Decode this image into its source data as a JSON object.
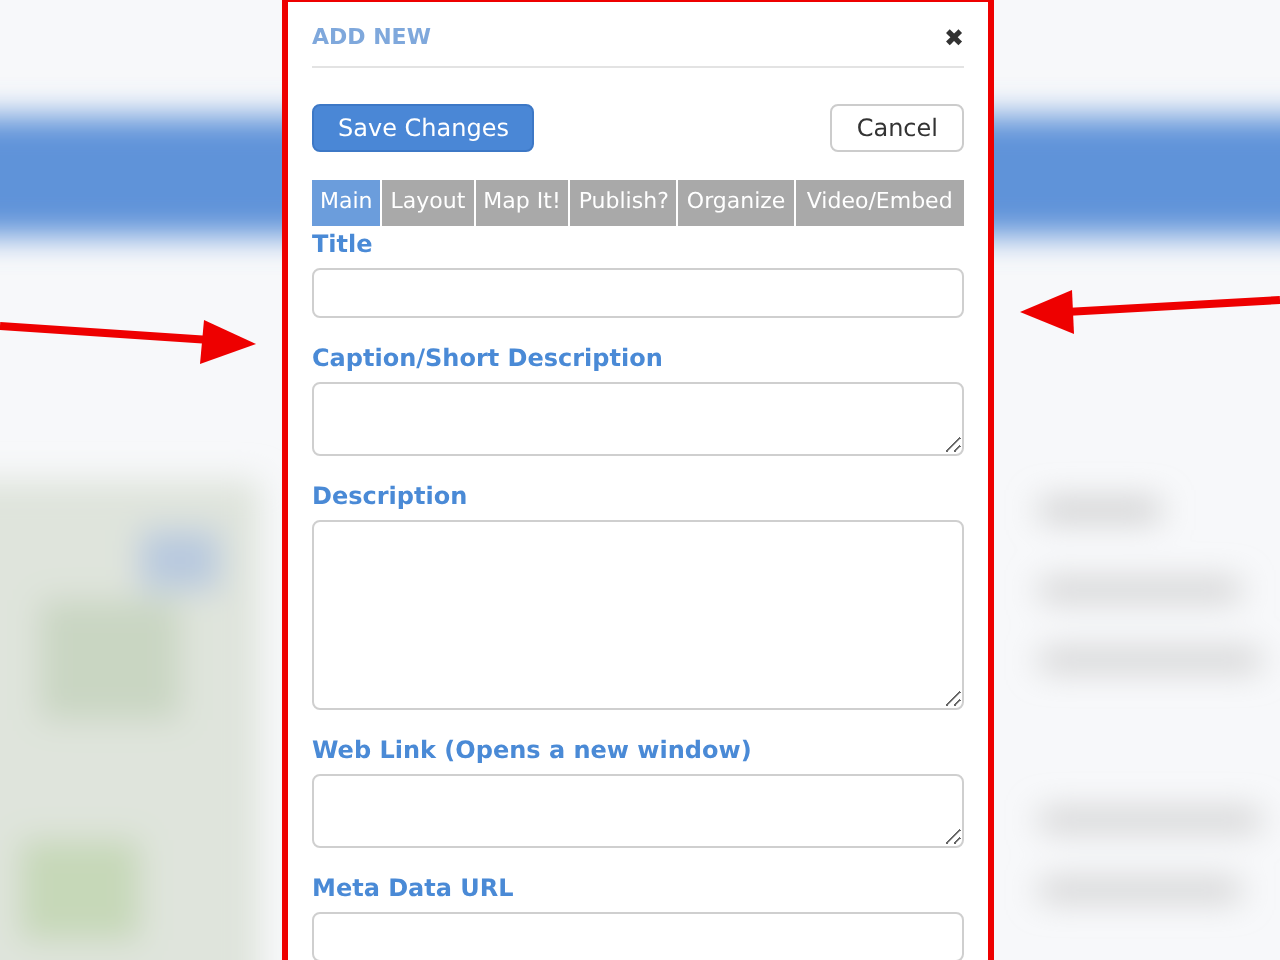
{
  "dialog": {
    "title": "ADD NEW",
    "close": "✖",
    "buttons": [
      {
        "label": "Save Changes",
        "kind": "primary"
      },
      {
        "label": "Cancel",
        "kind": "secondary"
      }
    ],
    "tabs": [
      {
        "label": "Main",
        "selected": true
      },
      {
        "label": "Layout",
        "selected": false
      },
      {
        "label": "Map It!",
        "selected": false
      },
      {
        "label": "Publish?",
        "selected": false
      },
      {
        "label": "Organize",
        "selected": false
      },
      {
        "label": "Video/Embed",
        "selected": false
      }
    ],
    "fields": [
      {
        "label": "Title",
        "kind": "input"
      },
      {
        "label": "Caption/Short Description",
        "kind": "textarea"
      },
      {
        "label": "Description",
        "kind": "tall-textarea"
      },
      {
        "label": "Web Link (Opens a new window)",
        "kind": "textarea"
      },
      {
        "label": "Meta Data URL",
        "kind": "input"
      }
    ]
  }
}
